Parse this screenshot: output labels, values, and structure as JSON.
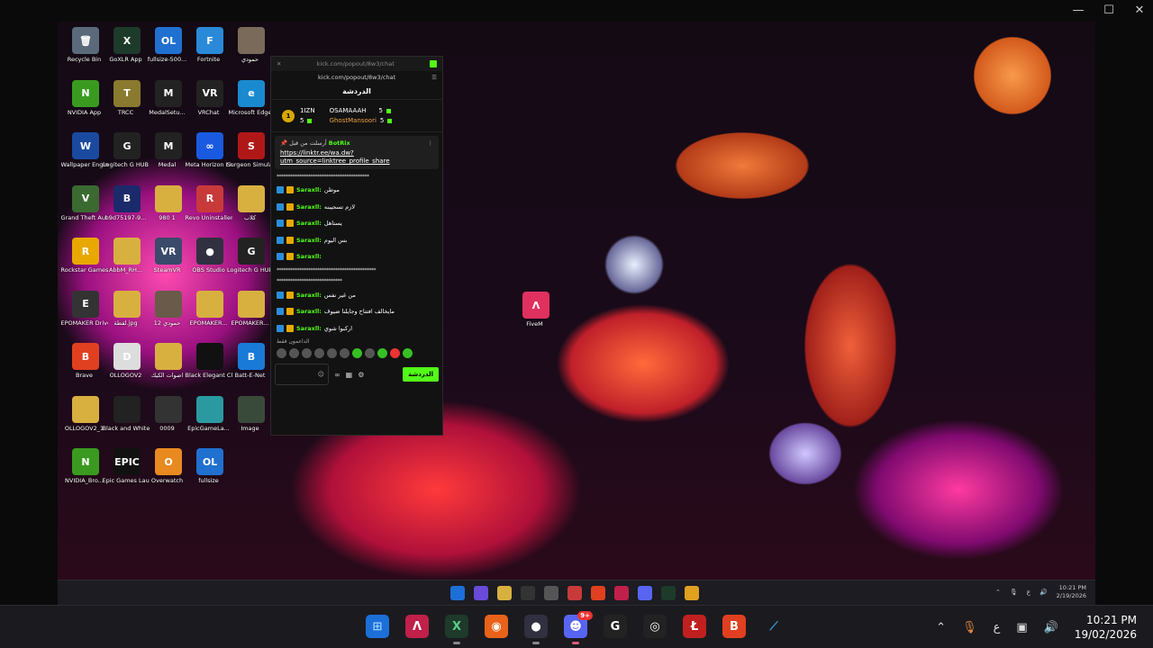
{
  "window": {
    "controls": [
      "—",
      "☐",
      "✕"
    ]
  },
  "desktop_icons": [
    {
      "label": "Recycle Bin",
      "color": "#5a6a7a",
      "glyph": "🗑"
    },
    {
      "label": "GoXLR App",
      "color": "#1e3a2a",
      "glyph": "X"
    },
    {
      "label": "fullsize-500...",
      "color": "#2070d0",
      "glyph": "OL"
    },
    {
      "label": "Fortnite",
      "color": "#2a8ad8",
      "glyph": "F"
    },
    {
      "label": "حمودي",
      "color": "#7a6a5a",
      "glyph": ""
    },
    {
      "label": "NVIDIA App",
      "color": "#3a9a20",
      "glyph": "N"
    },
    {
      "label": "TRCC",
      "color": "#8a7a30",
      "glyph": "T"
    },
    {
      "label": "MedalSetu...",
      "color": "#222",
      "glyph": "M"
    },
    {
      "label": "VRChat",
      "color": "#222",
      "glyph": "VR"
    },
    {
      "label": "Microsoft Edge",
      "color": "#1a8ad0",
      "glyph": "e"
    },
    {
      "label": "Wallpaper Engine",
      "color": "#1a4aa0",
      "glyph": "W"
    },
    {
      "label": "Logitech G HUB",
      "color": "#222",
      "glyph": "G"
    },
    {
      "label": "Medal",
      "color": "#222",
      "glyph": "M"
    },
    {
      "label": "Meta Horizon Link",
      "color": "#1a5ae0",
      "glyph": "∞"
    },
    {
      "label": "Surgeon Simulato...",
      "color": "#b01818",
      "glyph": "S"
    },
    {
      "label": "Grand Theft Auto V",
      "color": "#3a6a30",
      "glyph": "V"
    },
    {
      "label": "b9d75197-9...",
      "color": "#1a2a6a",
      "glyph": "B"
    },
    {
      "label": "980 1",
      "color": "#d8b040",
      "glyph": ""
    },
    {
      "label": "Revo Uninstaller",
      "color": "#c83a3a",
      "glyph": "R"
    },
    {
      "label": "كلاب",
      "color": "#d8b040",
      "glyph": ""
    },
    {
      "label": "Rockstar Games...",
      "color": "#e8a800",
      "glyph": "R"
    },
    {
      "label": "AbbM_RH...",
      "color": "#d8b040",
      "glyph": ""
    },
    {
      "label": "SteamVR",
      "color": "#3a4a6a",
      "glyph": "VR"
    },
    {
      "label": "OBS Studio",
      "color": "#303040",
      "glyph": "●"
    },
    {
      "label": "Logitech G HUB",
      "color": "#222",
      "glyph": "G"
    },
    {
      "label": "EPOMAKER Driver",
      "color": "#333",
      "glyph": "E"
    },
    {
      "label": "لقطة.jpg",
      "color": "#d8b040",
      "glyph": ""
    },
    {
      "label": "حمودي 12",
      "color": "#6a5a4a",
      "glyph": ""
    },
    {
      "label": "EPOMAKER...",
      "color": "#d8b040",
      "glyph": ""
    },
    {
      "label": "EPOMAKER...",
      "color": "#d8b040",
      "glyph": ""
    },
    {
      "label": "Brave",
      "color": "#e04020",
      "glyph": "B"
    },
    {
      "label": "OLLOGOV2",
      "color": "#ddd",
      "glyph": "D"
    },
    {
      "label": "اصوات الكيك",
      "color": "#d8b040",
      "glyph": ""
    },
    {
      "label": "Black Elegant Clean Smo...",
      "color": "#111",
      "glyph": ""
    },
    {
      "label": "Batt-E-Net",
      "color": "#1a7ad8",
      "glyph": "B"
    },
    {
      "label": "OLLOGOV2_1",
      "color": "#d8b040",
      "glyph": ""
    },
    {
      "label": "Black and White Mo...",
      "color": "#222",
      "glyph": ""
    },
    {
      "label": "0009",
      "color": "#333",
      "glyph": ""
    },
    {
      "label": "EpicGameLa...",
      "color": "#2a9aa0",
      "glyph": ""
    },
    {
      "label": "Image",
      "color": "#3a4a3a",
      "glyph": ""
    },
    {
      "label": "NVIDIA_Bro...",
      "color": "#3a9a20",
      "glyph": "N"
    },
    {
      "label": "Epic Games Launcher",
      "color": "#111",
      "glyph": "EPIC"
    },
    {
      "label": "Overwatch",
      "color": "#e88a20",
      "glyph": "O"
    },
    {
      "label": "fullsize",
      "color": "#2070d0",
      "glyph": "OL"
    }
  ],
  "fivem": {
    "label": "FiveM",
    "glyph": "Λ"
  },
  "chat": {
    "title_url": "kick.com/popout/8w3/chat",
    "url": "kick.com/popout/8w3/chat",
    "heading": "الدردشة",
    "leaders": [
      {
        "rank": "1",
        "name": "1IZN",
        "count": "5"
      },
      {
        "name": "OSAMAAAH",
        "count": "5"
      },
      {
        "name": "GhostMansoori",
        "count": "5"
      }
    ],
    "pinned": {
      "by": "أرسلت من قبل",
      "bot": "BotRix",
      "link": "https://linktr.ee/wa.dw?utm_source=linktree_profile_share"
    },
    "stars_a": "*****************************************",
    "messages_a": [
      {
        "user": "Saraxll:",
        "text": "موطن"
      },
      {
        "user": "Saraxll:",
        "text": "لازم تسجيبنه"
      },
      {
        "user": "Saraxll:",
        "text": "يستاهل"
      },
      {
        "user": "Saraxll:",
        "text": "بس اليوم"
      },
      {
        "user": "Saraxll:",
        "text": ""
      }
    ],
    "stars_b": "********************************************",
    "stars_c": "*****************************",
    "messages_b": [
      {
        "user": "Saraxll:",
        "text": "من غير نفس"
      },
      {
        "user": "Saraxll:",
        "text": "مايخالف افتتاح وجايلنا ضيوف"
      },
      {
        "user": "Saraxll:",
        "text": "اركبوا شوي"
      }
    ],
    "supporters": "الداعمون فقط",
    "send": "الدردشة"
  },
  "inner_clock": {
    "time": "10:21 PM",
    "date": "2/19/2026"
  },
  "taskbar": {
    "discord_badge": "9+",
    "lang": "ع",
    "time": "10:21 PM",
    "date": "19/02/2026"
  }
}
